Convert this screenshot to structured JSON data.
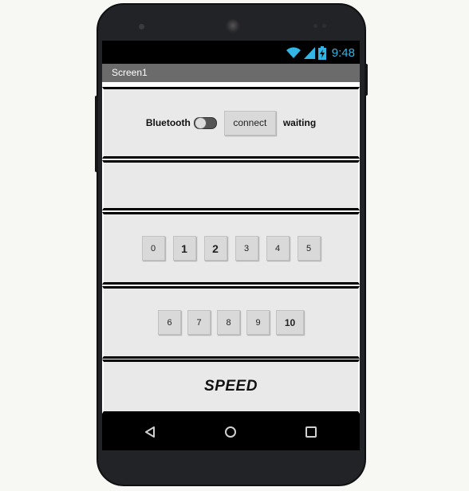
{
  "app": {
    "screen_title": "Screen1"
  },
  "status_bar": {
    "time": "9:48",
    "icons": [
      "wifi-icon",
      "signal-icon",
      "battery-charging-icon"
    ],
    "accent_color": "#33b5e5"
  },
  "bluetooth_row": {
    "label": "Bluetooth",
    "toggle_state": "off",
    "connect_label": "connect",
    "status_text": "waiting"
  },
  "number_rows": [
    [
      "0",
      "1",
      "2",
      "3",
      "4",
      "5"
    ],
    [
      "6",
      "7",
      "8",
      "9",
      "10"
    ]
  ],
  "speed_label": "SPEED",
  "nav_bar": {
    "icons": [
      "back-icon",
      "home-icon",
      "recents-icon"
    ]
  }
}
